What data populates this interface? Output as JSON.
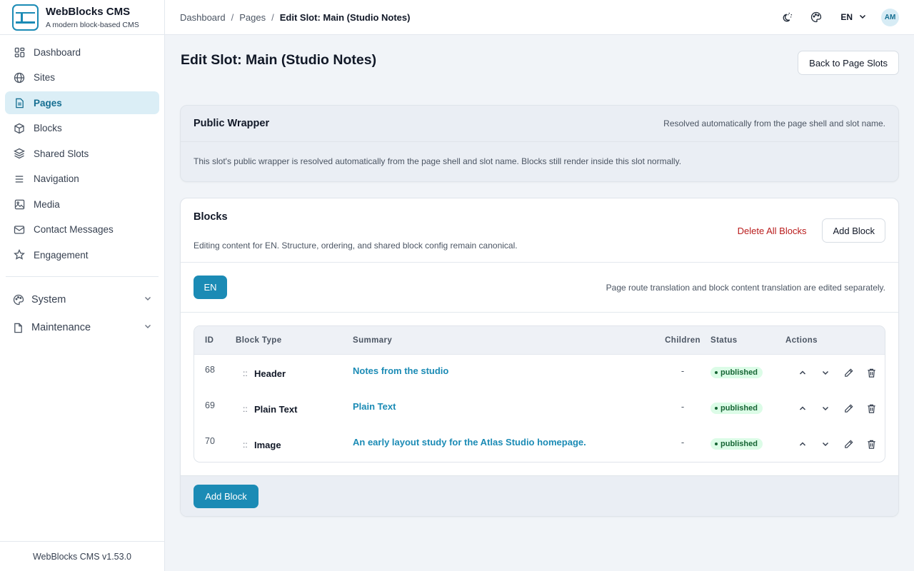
{
  "brand": {
    "name": "WebBlocks CMS",
    "tagline": "A modern block-based CMS"
  },
  "sidebar": {
    "items": [
      {
        "label": "Dashboard",
        "icon": "dashboard-icon"
      },
      {
        "label": "Sites",
        "icon": "globe-icon"
      },
      {
        "label": "Pages",
        "icon": "page-icon",
        "active": true
      },
      {
        "label": "Blocks",
        "icon": "cube-icon"
      },
      {
        "label": "Shared Slots",
        "icon": "layers-icon"
      },
      {
        "label": "Navigation",
        "icon": "menu-icon"
      },
      {
        "label": "Media",
        "icon": "image-icon"
      },
      {
        "label": "Contact Messages",
        "icon": "mail-icon"
      },
      {
        "label": "Engagement",
        "icon": "star-icon"
      }
    ],
    "groups": [
      {
        "label": "System",
        "icon": "palette-icon"
      },
      {
        "label": "Maintenance",
        "icon": "file-icon"
      }
    ],
    "footer": "WebBlocks CMS v1.53.0"
  },
  "topbar": {
    "breadcrumb": [
      "Dashboard",
      "Pages",
      "Edit Slot: Main (Studio Notes)"
    ],
    "separator": "/",
    "language": "EN",
    "avatar": "AM"
  },
  "page": {
    "title": "Edit Slot: Main (Studio Notes)",
    "back_button": "Back to Page Slots"
  },
  "wrapper": {
    "title": "Public Wrapper",
    "note": "Resolved automatically from the page shell and slot name.",
    "body": "This slot's public wrapper is resolved automatically from the page shell and slot name. Blocks still render inside this slot normally."
  },
  "blocks": {
    "title": "Blocks",
    "subtitle": "Editing content for EN. Structure, ordering, and shared block config remain canonical.",
    "delete_all": "Delete All Blocks",
    "add_block": "Add Block",
    "lang_button": "EN",
    "lang_note": "Page route translation and block content translation are edited separately.",
    "columns": [
      "ID",
      "Block Type",
      "Summary",
      "Children",
      "Status",
      "Actions"
    ],
    "rows": [
      {
        "id": "68",
        "drag": "::",
        "type": "Header",
        "summary": "Notes from the studio",
        "children": "-",
        "status": "published"
      },
      {
        "id": "69",
        "drag": "::",
        "type": "Plain Text",
        "summary": "Plain Text",
        "children": "-",
        "status": "published"
      },
      {
        "id": "70",
        "drag": "::",
        "type": "Image",
        "summary": "An early layout study for the Atlas Studio homepage.",
        "children": "-",
        "status": "published"
      }
    ],
    "footer_add": "Add Block"
  },
  "colors": {
    "accent": "#1b8bb5",
    "danger": "#b91c1c",
    "success_bg": "#dcfce7",
    "success_text": "#166534"
  }
}
